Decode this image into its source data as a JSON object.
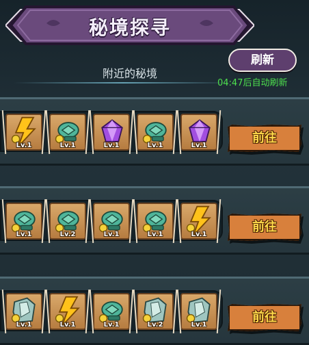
{
  "header": {
    "title": "秘境探寻",
    "subtitle": "附近的秘境",
    "refresh_label": "刷新",
    "timer_text": "04:47后自动刷新"
  },
  "colors": {
    "banner": "#6a4a7c",
    "go_button": "#d8803c",
    "timer_green": "#4ee04e"
  },
  "rows": [
    {
      "go_label": "前往",
      "items": [
        {
          "icon": "lightning-icon",
          "level": "Lv.1"
        },
        {
          "icon": "turtle-shell-icon",
          "level": "Lv.1"
        },
        {
          "icon": "purple-gem-icon",
          "level": "Lv.1"
        },
        {
          "icon": "turtle-shell-icon",
          "level": "Lv.1"
        },
        {
          "icon": "purple-gem-icon",
          "level": "Lv.1"
        }
      ]
    },
    {
      "go_label": "前往",
      "items": [
        {
          "icon": "turtle-shell-icon",
          "level": "Lv.1"
        },
        {
          "icon": "turtle-shell-icon",
          "level": "Lv.2"
        },
        {
          "icon": "turtle-shell-icon",
          "level": "Lv.1"
        },
        {
          "icon": "turtle-shell-icon",
          "level": "Lv.1"
        },
        {
          "icon": "lightning-icon",
          "level": "Lv.1"
        }
      ]
    },
    {
      "go_label": "前往",
      "items": [
        {
          "icon": "ice-crystal-icon",
          "level": "Lv.1"
        },
        {
          "icon": "lightning-icon",
          "level": "Lv.1"
        },
        {
          "icon": "turtle-shell-icon",
          "level": "Lv.1"
        },
        {
          "icon": "ice-crystal-icon",
          "level": "Lv.2"
        },
        {
          "icon": "ice-crystal-icon",
          "level": "Lv.1"
        }
      ]
    }
  ]
}
